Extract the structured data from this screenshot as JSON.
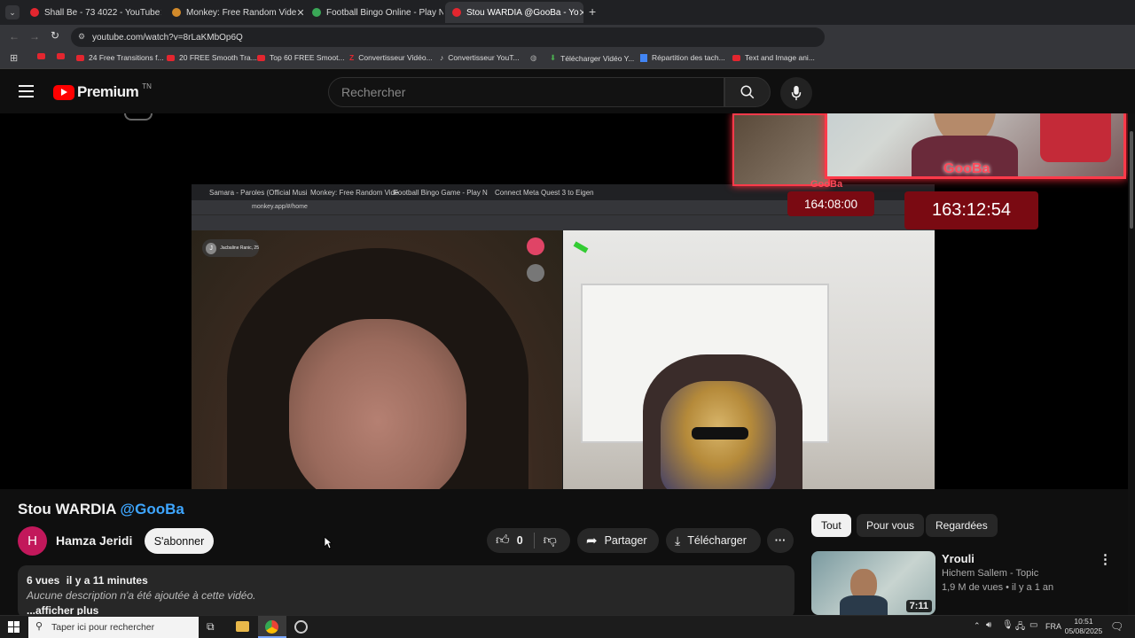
{
  "tabs": [
    {
      "label": "Shall Be - 73 4022 - YouTube",
      "color": "#e3262f"
    },
    {
      "label": "Monkey: Free Random Vide",
      "color": "#d28a2a"
    },
    {
      "label": "Football Bingo Online - Play No",
      "color": "#3aa757"
    },
    {
      "label": "Stou WARDIA @GooBa - Yo",
      "color": "#e3262f"
    }
  ],
  "address": "youtube.com/watch?v=8rLaKMbOp6Q",
  "bookmarks": [
    "24 Free Transitions f...",
    "20 FREE Smooth Tra...",
    "Top 60 FREE Smoot...",
    "Convertisseur Vidéo...",
    "Convertisseur YouT...",
    "Télécharger Vidéo Y...",
    "Répartition des tach...",
    "Text and Image ani..."
  ],
  "yt": {
    "logo": "Premium",
    "region": "TN",
    "search_placeholder": "Rechercher"
  },
  "video_overlay": {
    "tabs": [
      "Samara - Paroles (Official Musi",
      "Monkey: Free Random Vide",
      "Football Bingo Game - Play N",
      "Connect Meta Quest 3 to Eigen"
    ],
    "url": "monkey.app/#/home",
    "partner": "Jacbaline Ranic, 25",
    "streamer_name": "GooBa",
    "timer1": "164:08:00",
    "timer2": "163:12:54"
  },
  "video": {
    "title": "Stou WARDIA",
    "handle": "@GooBa",
    "channel": "Hamza Jeridi",
    "channel_initial": "H",
    "subscribe": "S'abonner",
    "likes": "0",
    "share": "Partager",
    "download": "Télécharger",
    "more": "···",
    "views": "6 vues",
    "time": "il y a 11 minutes",
    "no_desc": "Aucune description n'a été ajoutée à cette vidéo.",
    "show_more": "...afficher plus"
  },
  "chips": [
    "Tout",
    "Pour vous",
    "Regardées"
  ],
  "suggestion": {
    "title": "Yrouli",
    "channel": "Hichem Sallem - Topic",
    "meta": "1,9 M de vues • il y a 1 an",
    "duration": "7:11"
  },
  "taskbar": {
    "search": "Taper ici pour rechercher",
    "lang": "FRA",
    "time": "10:51",
    "date": "05/08/2025"
  }
}
